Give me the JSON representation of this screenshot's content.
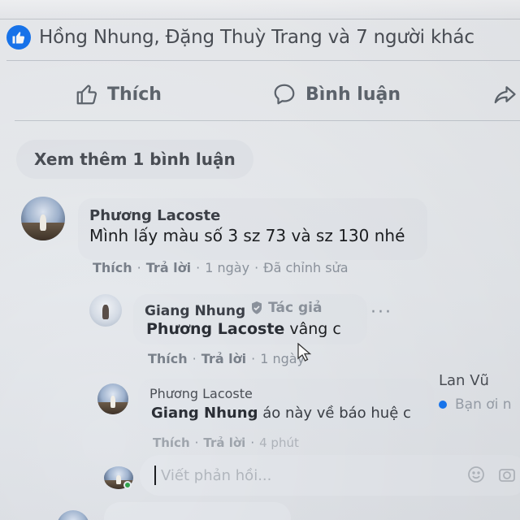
{
  "reactions": {
    "summary": "Hồng Nhung, Đặng Thuỳ Trang và 7 người khác"
  },
  "actions": {
    "like_label": "Thích",
    "comment_label": "Bình luận"
  },
  "see_more": "Xem thêm 1 bình luận",
  "comments": [
    {
      "author": "Phương Lacoste",
      "text": "Mình lấy màu số 3 sz 73 và sz 130 nhé",
      "like": "Thích",
      "reply": "Trả lời",
      "time": "1 ngày",
      "edited": "Đã chỉnh sửa"
    }
  ],
  "replies": [
    {
      "author": "Giang Nhung",
      "author_badge": "Tác giả",
      "mention": "Phương Lacoste",
      "text": "vâng c",
      "like": "Thích",
      "reply": "Trả lời",
      "time": "1 ngày"
    },
    {
      "author": "Phương Lacoste",
      "mention": "Giang Nhung",
      "text": "áo này về báo huệ c",
      "like": "Thích",
      "reply": "Trả lời",
      "time": "4 phút"
    }
  ],
  "sidebar": {
    "contact_name": "Lan Vũ",
    "message_preview": "Bạn ơi n"
  },
  "reply_box": {
    "placeholder": "Viết phản hồi..."
  },
  "colors": {
    "brand_blue": "#1877f2",
    "online_green": "#31a24c"
  },
  "icons": [
    "like-badge-icon",
    "thumbs-up-icon",
    "comment-icon",
    "share-icon",
    "shield-check-icon",
    "more-icon",
    "cursor-icon",
    "emoji-icon",
    "camera-icon"
  ]
}
